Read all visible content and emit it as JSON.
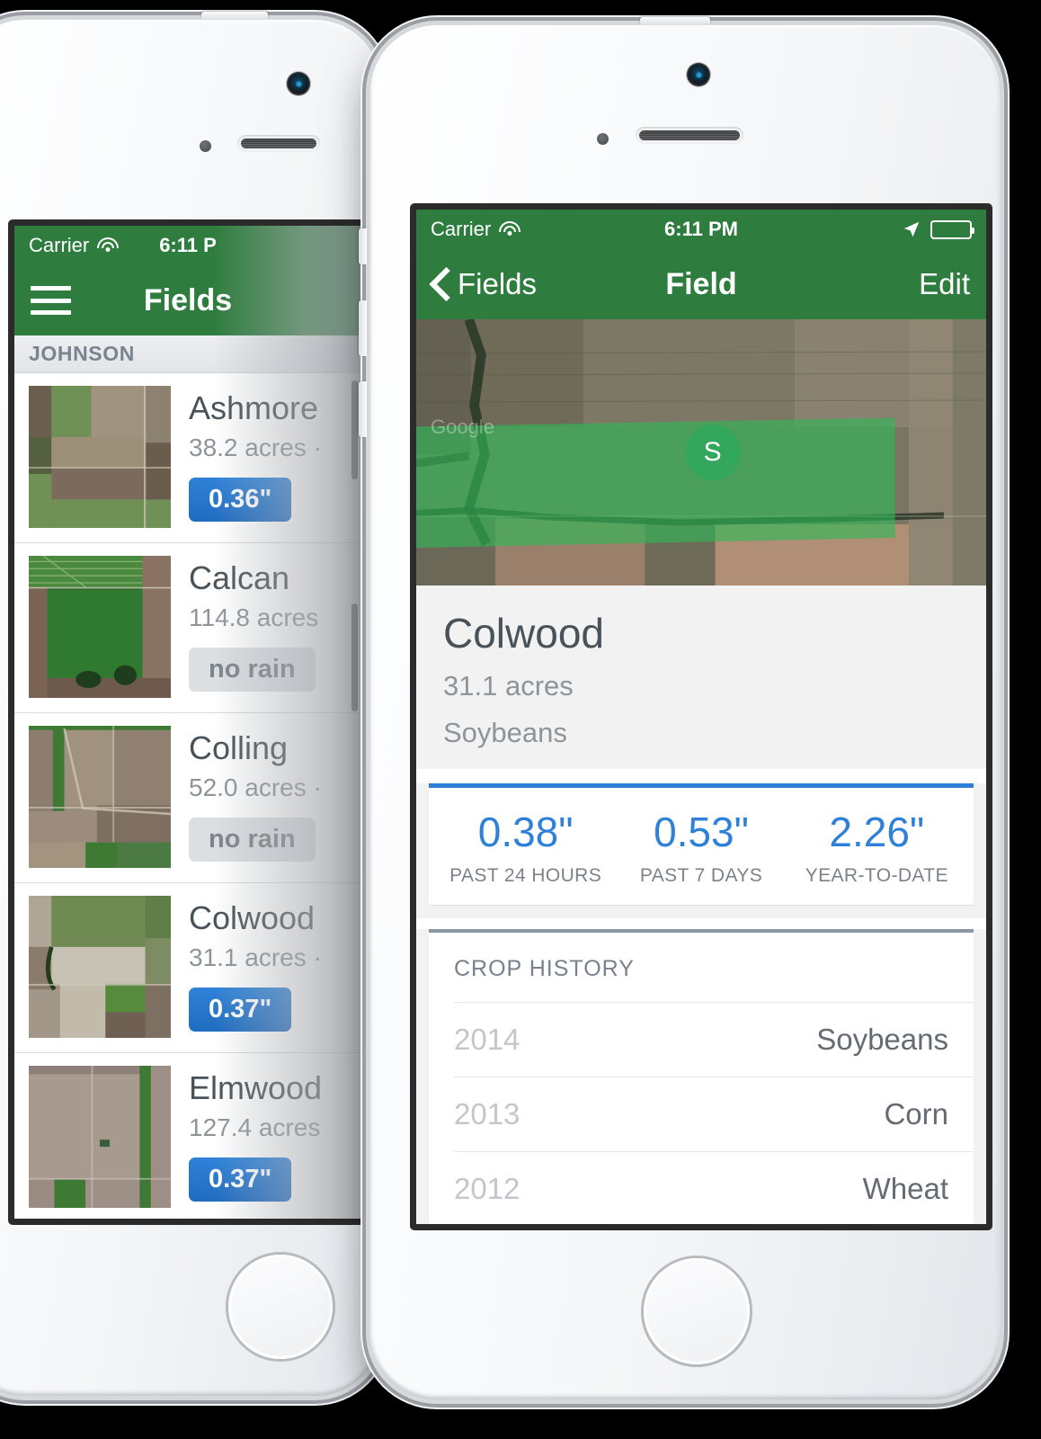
{
  "left_phone": {
    "status_bar": {
      "carrier": "Carrier",
      "time": "6:11 P",
      "wifi_icon": "wifi-icon"
    },
    "nav_bar": {
      "menu_icon": "hamburger-icon",
      "title": "Fields"
    },
    "section_header": "JOHNSON",
    "fields": [
      {
        "name": "Ashmore",
        "acres": "38.2 acres ·",
        "badge": "0.36\"",
        "badge_type": "rain"
      },
      {
        "name": "Calcan",
        "acres": "114.8 acres",
        "badge": "no rain",
        "badge_type": "norain"
      },
      {
        "name": "Colling",
        "acres": "52.0 acres ·",
        "badge": "no rain",
        "badge_type": "norain"
      },
      {
        "name": "Colwood",
        "acres": "31.1 acres ·",
        "badge": "0.37\"",
        "badge_type": "rain"
      },
      {
        "name": "Elmwood",
        "acres": "127.4 acres",
        "badge": "0.37\"",
        "badge_type": "rain"
      }
    ]
  },
  "right_phone": {
    "status_bar": {
      "carrier": "Carrier",
      "time": "6:11 PM",
      "wifi_icon": "wifi-icon",
      "location_icon": "location-arrow-icon",
      "battery_icon": "battery-icon"
    },
    "nav_bar": {
      "back_label": "Fields",
      "back_icon": "chevron-left-icon",
      "title": "Field",
      "edit_label": "Edit"
    },
    "map": {
      "pin_label": "S",
      "attribution": "Google"
    },
    "field": {
      "name": "Colwood",
      "acres": "31.1 acres",
      "crop": "Soybeans"
    },
    "rain_stats": [
      {
        "value": "0.38\"",
        "label": "PAST 24 HOURS"
      },
      {
        "value": "0.53\"",
        "label": "PAST 7 DAYS"
      },
      {
        "value": "2.26\"",
        "label": "YEAR-TO-DATE"
      }
    ],
    "crop_history": {
      "title": "CROP HISTORY",
      "rows": [
        {
          "year": "2014",
          "crop": "Soybeans"
        },
        {
          "year": "2013",
          "crop": "Corn"
        },
        {
          "year": "2012",
          "crop": "Wheat"
        }
      ]
    }
  },
  "colors": {
    "nav_green": "#2f7d3e",
    "accent_blue": "#2f80d8",
    "map_plot_green": "#2db955",
    "text_dark": "#4a5259",
    "text_muted": "#8d949a"
  }
}
